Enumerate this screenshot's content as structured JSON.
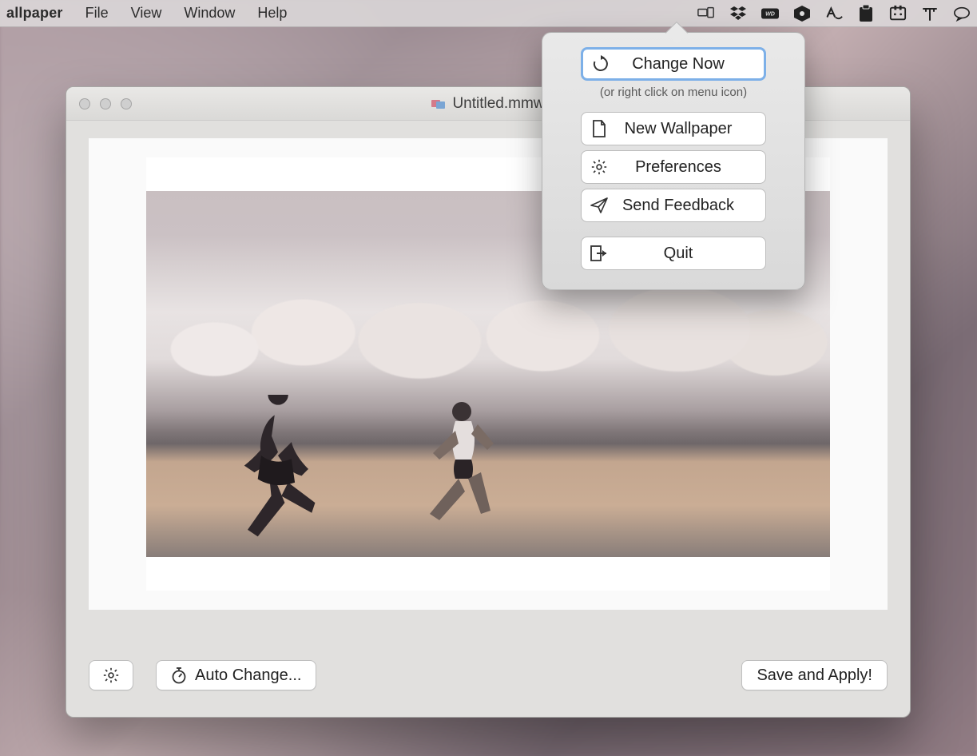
{
  "menubar": {
    "app_name": "allpaper",
    "items": [
      "File",
      "View",
      "Window",
      "Help"
    ],
    "status_icons": [
      "screens-icon",
      "dropbox-icon",
      "wd-icon",
      "sync-icon",
      "aws-icon",
      "clipboard-icon",
      "itch-icon",
      "type-icon",
      "chat-icon"
    ]
  },
  "window": {
    "title": "Untitled.mmw"
  },
  "bottom": {
    "auto_change": "Auto Change...",
    "save_apply": "Save and Apply!"
  },
  "panel": {
    "change_now": "Change Now",
    "hint": "(or right click on menu icon)",
    "new_wallpaper": "New Wallpaper",
    "preferences": "Preferences",
    "send_feedback": "Send Feedback",
    "quit": "Quit"
  }
}
